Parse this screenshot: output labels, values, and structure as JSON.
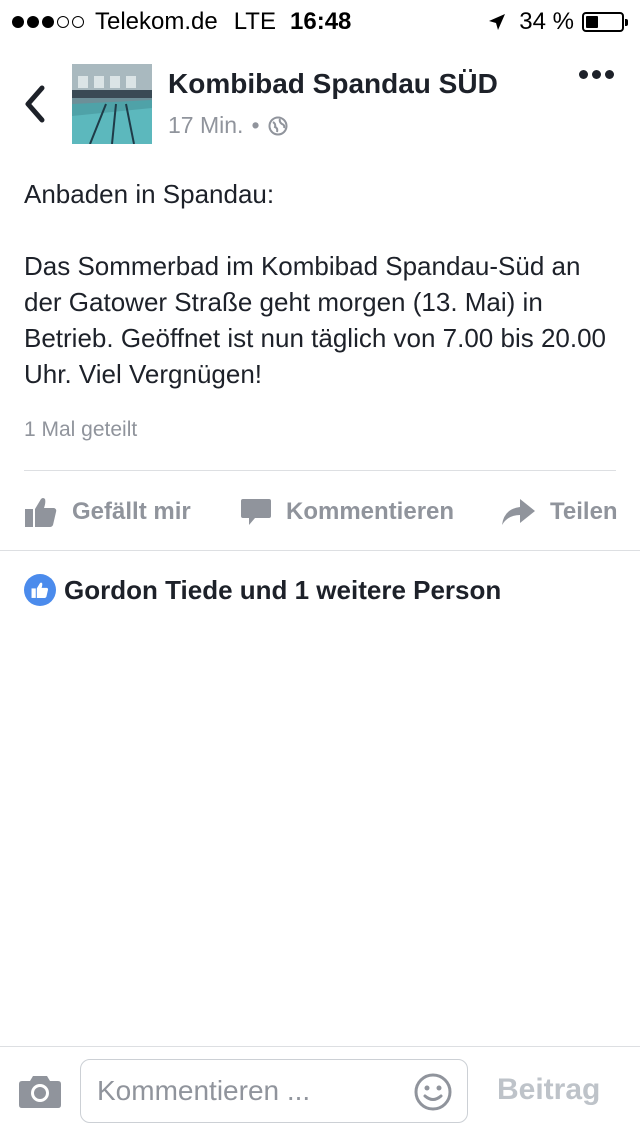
{
  "status_bar": {
    "carrier": "Telekom.de",
    "network": "LTE",
    "time": "16:48",
    "battery_percent": "34 %",
    "battery_level": 0.34,
    "signal_bars_filled": 3,
    "signal_bars_total": 5
  },
  "header": {
    "page_name": "Kombibad Spandau SÜD",
    "post_age": "17 Min.",
    "separator": "•",
    "icons": [
      "chevron-left-icon",
      "globe-icon",
      "more-dots-icon"
    ]
  },
  "post": {
    "intro": "Anbaden in Spandau:",
    "body": "Das Sommerbad im Kombibad Spandau-Süd an der Gatower Straße geht morgen (13. Mai) in Betrieb. Geöffnet ist nun täglich von 7.00 bis 20.00 Uhr. Viel Vergnügen!",
    "shares": "1 Mal geteilt"
  },
  "actions": {
    "like_label": "Gefällt mir",
    "comment_label": "Kommentieren",
    "share_label": "Teilen"
  },
  "likes": {
    "text": "Gordon Tiede und 1 weitere Person"
  },
  "composer": {
    "placeholder": "Kommentieren ...",
    "send_label": "Beitrag"
  },
  "colors": {
    "text": "#1d2129",
    "muted": "#90949c",
    "like_blue": "#4b8bec",
    "divider": "#dddfe2"
  }
}
